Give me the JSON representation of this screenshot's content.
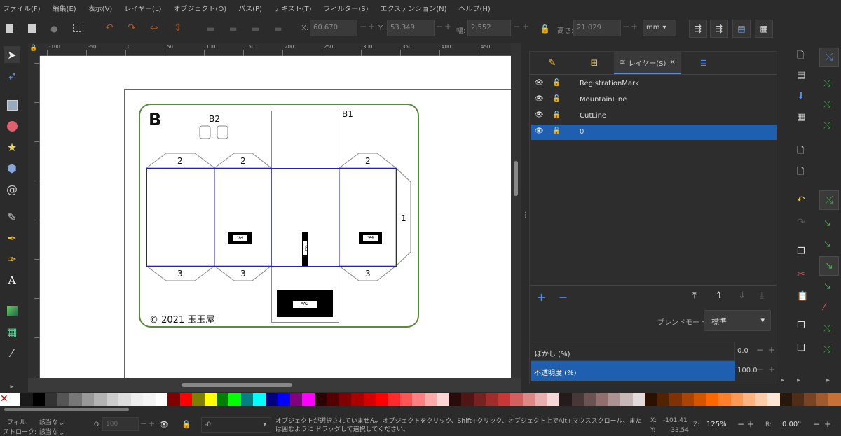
{
  "menu": [
    "ファイル(F)",
    "編集(E)",
    "表示(V)",
    "レイヤー(L)",
    "オブジェクト(O)",
    "パス(P)",
    "テキスト(T)",
    "フィルター(S)",
    "エクステンション(N)",
    "ヘルプ(H)"
  ],
  "toolbar": {
    "x_label": "X:",
    "x_value": "60.670",
    "y_label": "Y:",
    "y_value": "53.349",
    "w_label": "幅:",
    "w_value": "2.552",
    "h_label": "高さ:",
    "h_value": "21.029",
    "unit": "mm"
  },
  "ruler_labels": [
    "-100",
    "-50",
    "0",
    "50",
    "100",
    "150",
    "200",
    "250",
    "300",
    "350",
    "400",
    "450"
  ],
  "design": {
    "label_b1": "B1",
    "label_b2": "B2",
    "logo": "B",
    "tab2": "2",
    "tab3": "3",
    "tab1": "1",
    "code_a4": "*A4",
    "code_a3": "*A3",
    "code_a2": "*A2",
    "copyright": "© 2021 玉玉屋"
  },
  "panel": {
    "tab_layers": "レイヤー(S)",
    "layers": [
      "RegistrationMark",
      "MountainLine",
      "CutLine",
      "0"
    ],
    "selected_layer": "0",
    "blend_label": "ブレンドモード:",
    "blend_value": "標準",
    "blur_label": "ぼかし (%)",
    "blur_value": "0.0",
    "opacity_label": "不透明度 (%)",
    "opacity_value": "100.0"
  },
  "status": {
    "fill_label": "フィル:",
    "fill_value": "該当なし",
    "stroke_label": "ストローク:",
    "stroke_value": "該当なし",
    "o_label": "O:",
    "o_value": "100",
    "layer_value": "-0",
    "message": "オブジェクトが選択されていません。オブジェクトをクリック、Shift+クリック、オブジェクト上でAlt+マウススクロール、または囲むように ドラッグして選択してください。",
    "x_label": "X:",
    "x_value": "-101.41",
    "y_label": "Y:",
    "y_value": "-33.54",
    "z_label": "Z:",
    "zoom": "125%",
    "r_label": "R:",
    "rotation": "0.00°"
  },
  "palette": [
    "#ffffff",
    "#1a1a1a",
    "#000000",
    "#333333",
    "#555555",
    "#777777",
    "#999999",
    "#b3b3b3",
    "#cccccc",
    "#dddddd",
    "#eeeeee",
    "#f5f5f5",
    "#ffffff",
    "#800000",
    "#ff0000",
    "#808000",
    "#ffff00",
    "#008000",
    "#00ff00",
    "#008080",
    "#00ffff",
    "#000080",
    "#0000ff",
    "#800080",
    "#ff00ff",
    "#2b0000",
    "#550000",
    "#800000",
    "#aa0000",
    "#d40000",
    "#ff0000",
    "#ff2a2a",
    "#ff5555",
    "#ff8080",
    "#ffaaaa",
    "#ffd5d5",
    "#280b0b",
    "#501616",
    "#782121",
    "#a02c2c",
    "#c83737",
    "#d35f5f",
    "#de8787",
    "#e9afaf",
    "#f4d7d7",
    "#241c1c",
    "#483737",
    "#6c5353",
    "#916f6f",
    "#ac9393",
    "#c8b7b7",
    "#e3dbdb",
    "#2b1100",
    "#552200",
    "#803300",
    "#aa4400",
    "#d45500",
    "#ff6600",
    "#ff7f2a",
    "#ff9955",
    "#ffb380",
    "#ffccaa",
    "#ffe6d5",
    "#28170b",
    "#502d16",
    "#784421",
    "#a05a2c",
    "#c87137"
  ]
}
